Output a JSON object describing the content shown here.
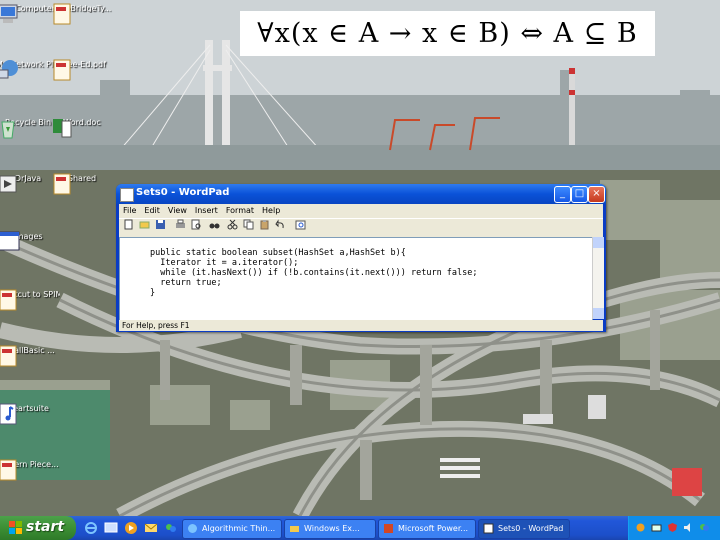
{
  "formula": {
    "text": "∀x(x ∈ A → x ∈ B) ⇔ A ⊆ B"
  },
  "desktop_icons": [
    {
      "label": "My Computer",
      "icon": "my-computer-icon"
    },
    {
      "label": "BlueBridgeTy...",
      "icon": "pdf-document-icon"
    },
    {
      "label": "My Network Places",
      "icon": "network-places-icon"
    },
    {
      "label": "chee-Ed.pdf",
      "icon": "pdf-document-icon"
    },
    {
      "label": "Recycle Bin",
      "icon": "recycle-bin-icon"
    },
    {
      "label": "Word.doc",
      "icon": "spreadsheet-doc-icon"
    },
    {
      "label": "DrJava",
      "icon": "java-app-icon"
    },
    {
      "label": "Shared",
      "icon": "pdf-document-icon"
    },
    {
      "label": "Images",
      "icon": "window-shortcut-icon"
    },
    {
      "label": "Shortcut to SPIM.exe",
      "icon": "pdf-document-icon"
    },
    {
      "label": "SmallBasic ...",
      "icon": "pdf-document-icon"
    },
    {
      "label": "Heartsuite",
      "icon": "music-note-icon"
    },
    {
      "label": "Modern Piece...",
      "icon": "pdf-document-icon"
    }
  ],
  "wordpad": {
    "title": "Sets0 - WordPad",
    "menu": [
      "File",
      "Edit",
      "View",
      "Insert",
      "Format",
      "Help"
    ],
    "code_lines": [
      "public static boolean subset(HashSet a,HashSet b){",
      "  Iterator it = a.iterator();",
      "  while (it.hasNext()) if (!b.contains(it.next())) return false;",
      "  return true;",
      "}"
    ],
    "status": "For Help, press F1"
  },
  "taskbar": {
    "start_label": "start",
    "tasks": [
      {
        "label": "Algorithmic Thin...",
        "active": false
      },
      {
        "label": "Windows Ex...",
        "active": false
      },
      {
        "label": "Microsoft Power...",
        "active": false
      },
      {
        "label": "Sets0 - WordPad",
        "active": true
      }
    ]
  },
  "colors": {
    "taskbar_blue": "#2157d9",
    "start_green": "#3c8f34",
    "titlebar_blue": "#0a52d8",
    "tray_blue": "#0f8dea"
  }
}
